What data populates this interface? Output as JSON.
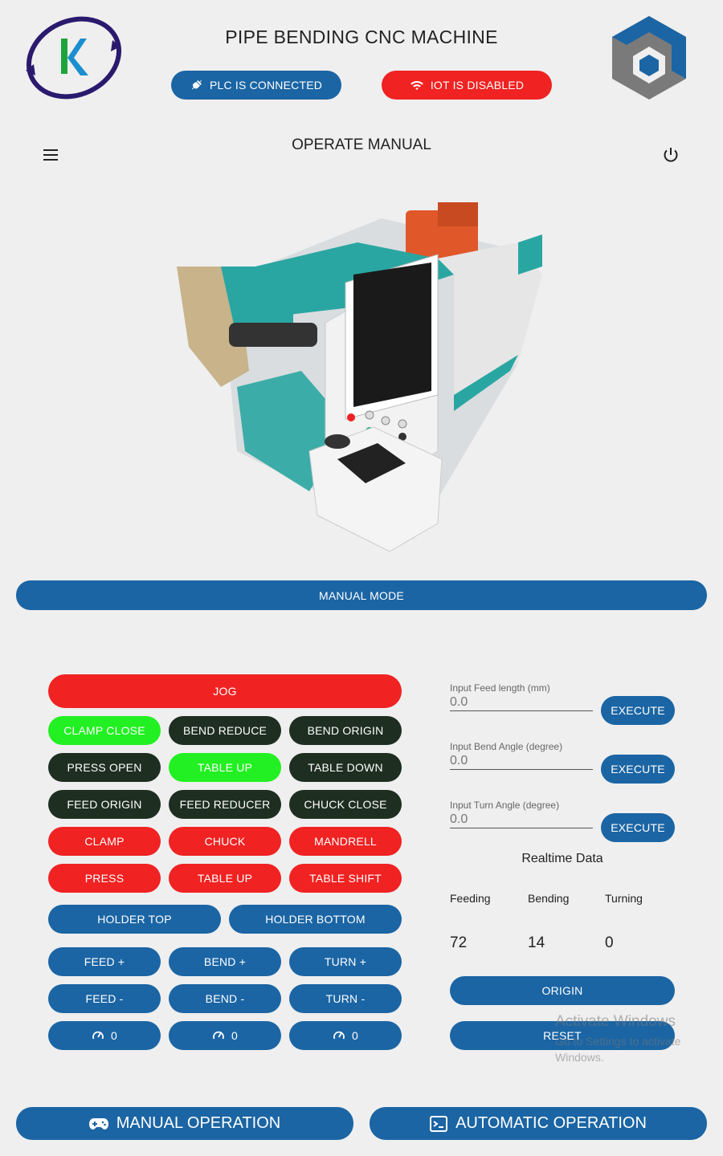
{
  "header": {
    "title": "PIPE BENDING CNC MACHINE",
    "plc_status": "PLC IS CONNECTED",
    "iot_status": "IOT IS DISABLED"
  },
  "page": {
    "subtitle": "OPERATE MANUAL",
    "mode_label": "MANUAL MODE"
  },
  "controls": {
    "jog": "JOG",
    "row1": [
      "CLAMP CLOSE",
      "BEND REDUCE",
      "BEND ORIGIN"
    ],
    "row2": [
      "PRESS OPEN",
      "TABLE UP",
      "TABLE DOWN"
    ],
    "row3": [
      "FEED ORIGIN",
      "FEED REDUCER",
      "CHUCK CLOSE"
    ],
    "row4": [
      "CLAMP",
      "CHUCK",
      "MANDRELL"
    ],
    "row5": [
      "PRESS",
      "TABLE UP",
      "TABLE SHIFT"
    ],
    "holder_top": "HOLDER TOP",
    "holder_bottom": "HOLDER BOTTOM",
    "plus": [
      "FEED +",
      "BEND +",
      "TURN +"
    ],
    "minus": [
      "FEED -",
      "BEND -",
      "TURN -"
    ],
    "speeds": [
      "0",
      "0",
      "0"
    ]
  },
  "inputs": {
    "feed_label": "Input Feed length (mm)",
    "feed_value": "0.0",
    "bend_label": "Input Bend Angle (degree)",
    "bend_value": "0.0",
    "turn_label": "Input Turn Angle (degree)",
    "turn_value": "0.0",
    "execute": "EXECUTE"
  },
  "realtime": {
    "title": "Realtime Data",
    "feeding_label": "Feeding",
    "bending_label": "Bending",
    "turning_label": "Turning",
    "feeding": "72",
    "bending": "14",
    "turning": "0",
    "origin": "ORIGIN",
    "reset": "RESET"
  },
  "watermark": {
    "line1": "Activate Windows",
    "line2": "Go to Settings to activate Windows."
  },
  "footer": {
    "manual": "MANUAL OPERATION",
    "automatic": "AUTOMATIC OPERATION"
  },
  "colors": {
    "blue": "#1b65a4",
    "red": "#f02222",
    "dark": "#1e2e21",
    "green": "#22f022",
    "teal": "#2aa6a2"
  },
  "icons": [
    "plug-icon",
    "wifi-icon",
    "menu-icon",
    "power-icon",
    "speed-icon",
    "gamepad-icon",
    "terminal-icon"
  ]
}
